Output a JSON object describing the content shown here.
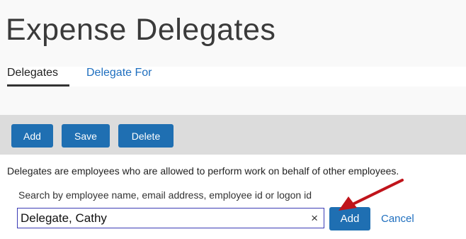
{
  "page": {
    "title": "Expense Delegates"
  },
  "tabs": [
    {
      "label": "Delegates",
      "active": true
    },
    {
      "label": "Delegate For",
      "active": false
    }
  ],
  "toolbar": {
    "add_label": "Add",
    "save_label": "Save",
    "delete_label": "Delete"
  },
  "main": {
    "description": "Delegates are employees who are allowed to perform work on behalf of other employees.",
    "search_label": "Search by employee name, email address, employee id or logon id",
    "search_value": "Delegate, Cathy",
    "clear_icon": "×",
    "add_button_label": "Add",
    "cancel_label": "Cancel"
  },
  "icons": {
    "clear": "close-icon",
    "annotation": "red-arrow-icon"
  },
  "colors": {
    "button": "#1f6fb2",
    "link": "#1f6fbf",
    "toolbar_bg": "#dcdcdc",
    "arrow": "#c0141b"
  }
}
